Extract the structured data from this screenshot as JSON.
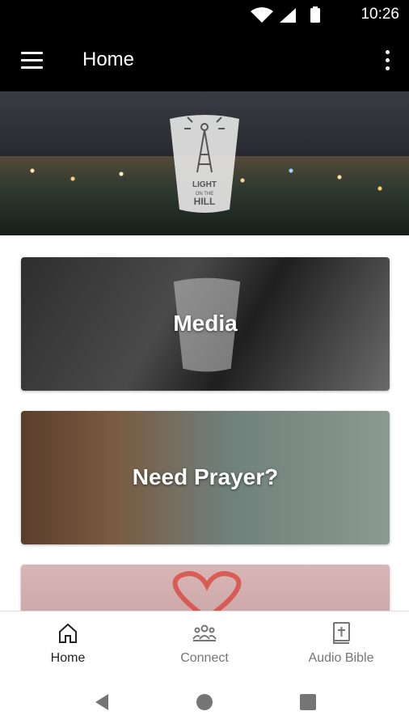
{
  "status_bar": {
    "time": "10:26"
  },
  "app_bar": {
    "title": "Home"
  },
  "hero": {
    "logo_text": "LIGHT ON THE HILL"
  },
  "cards": [
    {
      "title": "Media"
    },
    {
      "title": "Need Prayer?"
    },
    {
      "title": ""
    }
  ],
  "bottom_nav": {
    "items": [
      {
        "label": "Home",
        "icon": "home-icon",
        "active": true
      },
      {
        "label": "Connect",
        "icon": "people-icon",
        "active": false
      },
      {
        "label": "Audio Bible",
        "icon": "book-plus-icon",
        "active": false
      }
    ]
  },
  "system_nav": {
    "buttons": [
      "back-icon",
      "home-circle-icon",
      "recents-icon"
    ]
  }
}
